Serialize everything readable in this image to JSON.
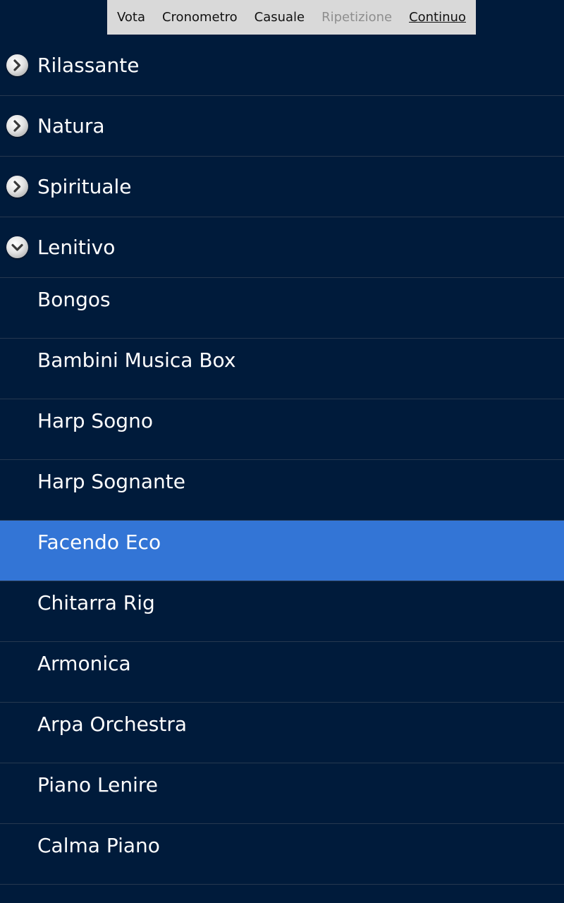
{
  "menu": {
    "items": [
      {
        "label": "Vota",
        "state": "normal"
      },
      {
        "label": "Cronometro",
        "state": "normal"
      },
      {
        "label": "Casuale",
        "state": "normal"
      },
      {
        "label": "Ripetizione",
        "state": "disabled"
      },
      {
        "label": "Continuo",
        "state": "active"
      }
    ]
  },
  "groups": [
    {
      "label": "Rilassante",
      "expanded": false,
      "icon": "chevron-right-icon"
    },
    {
      "label": "Natura",
      "expanded": false,
      "icon": "chevron-right-icon"
    },
    {
      "label": "Spirituale",
      "expanded": false,
      "icon": "chevron-right-icon"
    },
    {
      "label": "Lenitivo",
      "expanded": true,
      "icon": "chevron-down-icon"
    }
  ],
  "tracks": [
    {
      "label": "Bongos",
      "selected": false
    },
    {
      "label": "Bambini Musica Box",
      "selected": false
    },
    {
      "label": "Harp Sogno",
      "selected": false
    },
    {
      "label": "Harp Sognante",
      "selected": false
    },
    {
      "label": "Facendo Eco",
      "selected": true
    },
    {
      "label": "Chitarra Rig",
      "selected": false
    },
    {
      "label": "Armonica",
      "selected": false
    },
    {
      "label": "Arpa Orchestra",
      "selected": false
    },
    {
      "label": "Piano Lenire",
      "selected": false
    },
    {
      "label": "Calma Piano",
      "selected": false
    }
  ],
  "colors": {
    "background": "#001b3b",
    "selected": "#3375d6",
    "menu_background": "#d9d9d9",
    "divider": "#26384f"
  }
}
